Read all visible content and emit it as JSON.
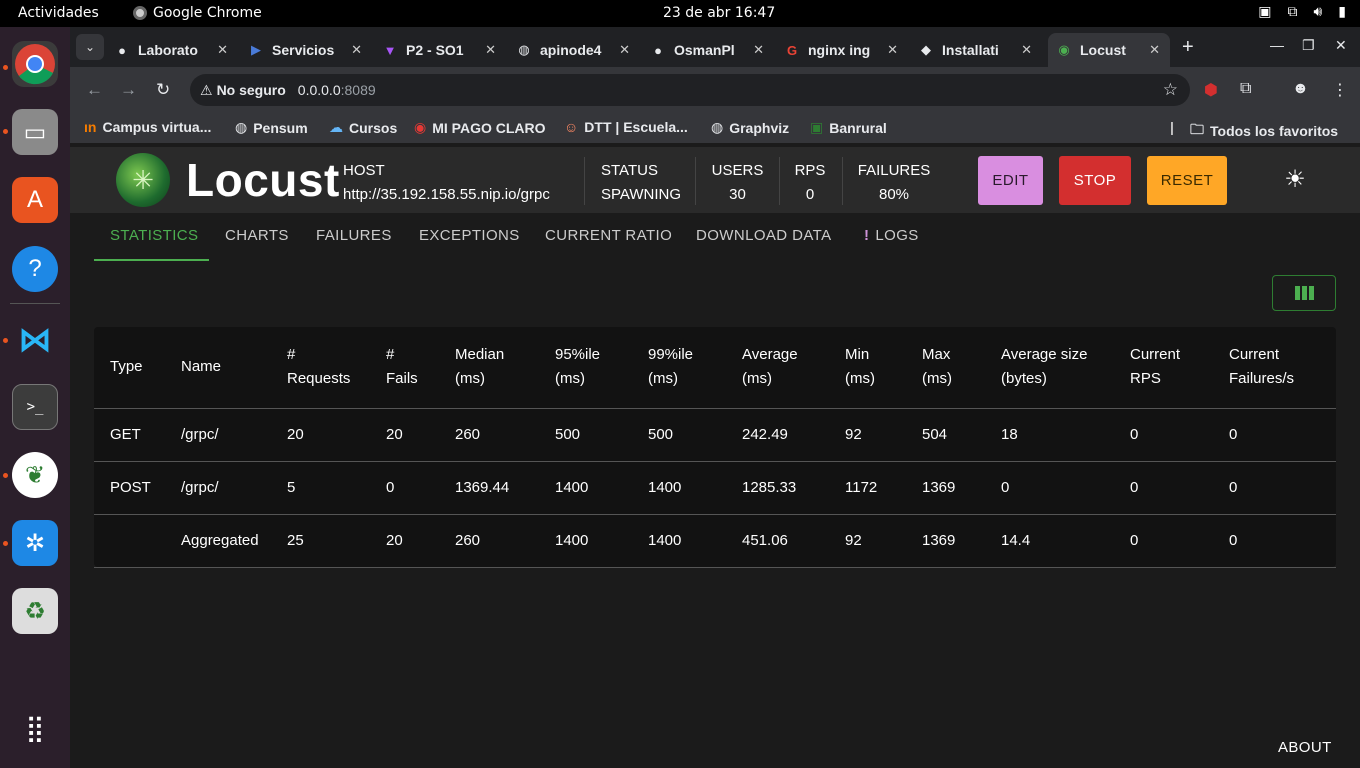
{
  "os": {
    "activities": "Actividades",
    "app_name": "Google Chrome",
    "clock": "23 de abr  16:47"
  },
  "browser": {
    "tabs": [
      {
        "title": "Laborato",
        "icon": "github-icon"
      },
      {
        "title": "Servicios",
        "icon": "azure-devops-icon"
      },
      {
        "title": "P2 - SO1",
        "icon": "vite-icon"
      },
      {
        "title": "apinode4",
        "icon": "globe-icon"
      },
      {
        "title": "OsmanPl",
        "icon": "github-icon"
      },
      {
        "title": "nginx ing",
        "icon": "google-icon"
      },
      {
        "title": "Installati",
        "icon": "cube-icon"
      },
      {
        "title": "Locust",
        "icon": "locust-icon"
      }
    ],
    "address": {
      "security": "No seguro",
      "url": "0.0.0.0",
      "port": ":8089"
    },
    "bookmarks": [
      "Campus virtua...",
      "Pensum",
      "Cursos",
      "MI PAGO CLARO",
      "DTT | Escuela...",
      "Graphviz",
      "Banrural"
    ],
    "all_bookmarks": "Todos los favoritos"
  },
  "locust": {
    "brand": "Locust",
    "host_label": "HOST",
    "host_value": "http://35.192.158.55.nip.io/grpc",
    "status_label": "STATUS",
    "status_value": "SPAWNING",
    "users_label": "USERS",
    "users_value": "30",
    "rps_label": "RPS",
    "rps_value": "0",
    "failures_label": "FAILURES",
    "failures_value": "80%",
    "edit": "EDIT",
    "stop": "STOP",
    "reset": "RESET",
    "tabs": [
      "STATISTICS",
      "CHARTS",
      "FAILURES",
      "EXCEPTIONS",
      "CURRENT RATIO",
      "DOWNLOAD DATA",
      "LOGS"
    ],
    "about": "ABOUT",
    "table": {
      "headers": [
        [
          "Type",
          ""
        ],
        [
          "Name",
          ""
        ],
        [
          "#",
          "Requests"
        ],
        [
          "#",
          "Fails"
        ],
        [
          "Median",
          "(ms)"
        ],
        [
          "95%ile",
          "(ms)"
        ],
        [
          "99%ile",
          "(ms)"
        ],
        [
          "Average",
          "(ms)"
        ],
        [
          "Min",
          "(ms)"
        ],
        [
          "Max",
          "(ms)"
        ],
        [
          "Average size",
          "(bytes)"
        ],
        [
          "Current",
          "RPS"
        ],
        [
          "Current",
          "Failures/s"
        ]
      ],
      "rows": [
        [
          "GET",
          "/grpc/",
          "20",
          "20",
          "260",
          "500",
          "500",
          "242.49",
          "92",
          "504",
          "18",
          "0",
          "0"
        ],
        [
          "POST",
          "/grpc/",
          "5",
          "0",
          "1369.44",
          "1400",
          "1400",
          "1285.33",
          "1172",
          "1369",
          "0",
          "0",
          "0"
        ],
        [
          "",
          "Aggregated",
          "25",
          "20",
          "260",
          "1400",
          "1400",
          "451.06",
          "92",
          "1369",
          "14.4",
          "0",
          "0"
        ]
      ]
    }
  },
  "colors": {
    "edit_bg": "#d98ee0",
    "stop_bg": "#d32f2f",
    "reset_bg": "#ffa726",
    "accent_green": "#4caf50"
  }
}
